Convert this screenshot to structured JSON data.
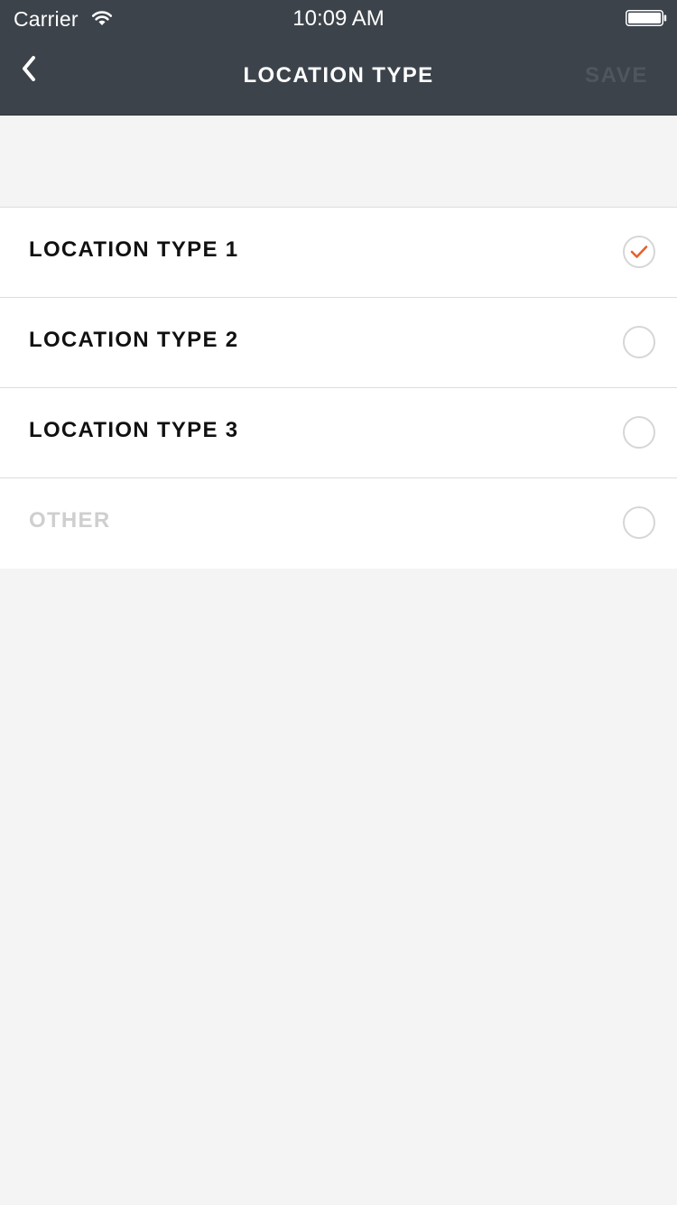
{
  "status_bar": {
    "carrier": "Carrier",
    "time": "10:09 AM",
    "wifi_icon": "wifi-icon",
    "battery_icon": "battery-icon"
  },
  "nav": {
    "back_icon": "chevron-left-icon",
    "title": "LOCATION TYPE",
    "save_label": "SAVE"
  },
  "options": [
    {
      "label": "LOCATION TYPE 1",
      "selected": true
    },
    {
      "label": "LOCATION TYPE 2",
      "selected": false
    },
    {
      "label": "LOCATION TYPE 3",
      "selected": false
    },
    {
      "label": "OTHER",
      "selected": false,
      "muted": true
    }
  ],
  "colors": {
    "nav_background": "#3c434b",
    "page_background": "#f4f4f4",
    "accent_check": "#e8602c",
    "save_disabled": "#4f565e",
    "muted_text": "#cfcfcf"
  }
}
